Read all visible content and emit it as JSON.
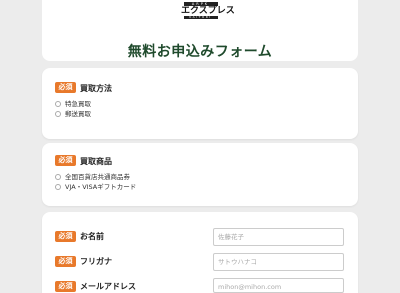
{
  "header": {
    "logo_top": "ARPK",
    "logo_main": "エクスプレス",
    "logo_sub": "KAITORI",
    "title": "無料お申込みフォーム"
  },
  "required_badge": "必須",
  "sections": {
    "purchase_method": {
      "label": "買取方法",
      "options": [
        "特急買取",
        "郵送買取"
      ]
    },
    "purchase_item": {
      "label": "買取商品",
      "options": [
        "全国百貨店共通商品券",
        "VJA・VISAギフトカード"
      ]
    },
    "personal": {
      "name_label": "お名前",
      "name_placeholder": "佐藤花子",
      "kana_label": "フリガナ",
      "kana_placeholder": "サトウハナコ",
      "email_label": "メールアドレス",
      "email_placeholder": "mihon@mihon.com"
    }
  },
  "colors": {
    "badge": "#e8792b",
    "title": "#1f4a2c",
    "background": "#ececec"
  }
}
